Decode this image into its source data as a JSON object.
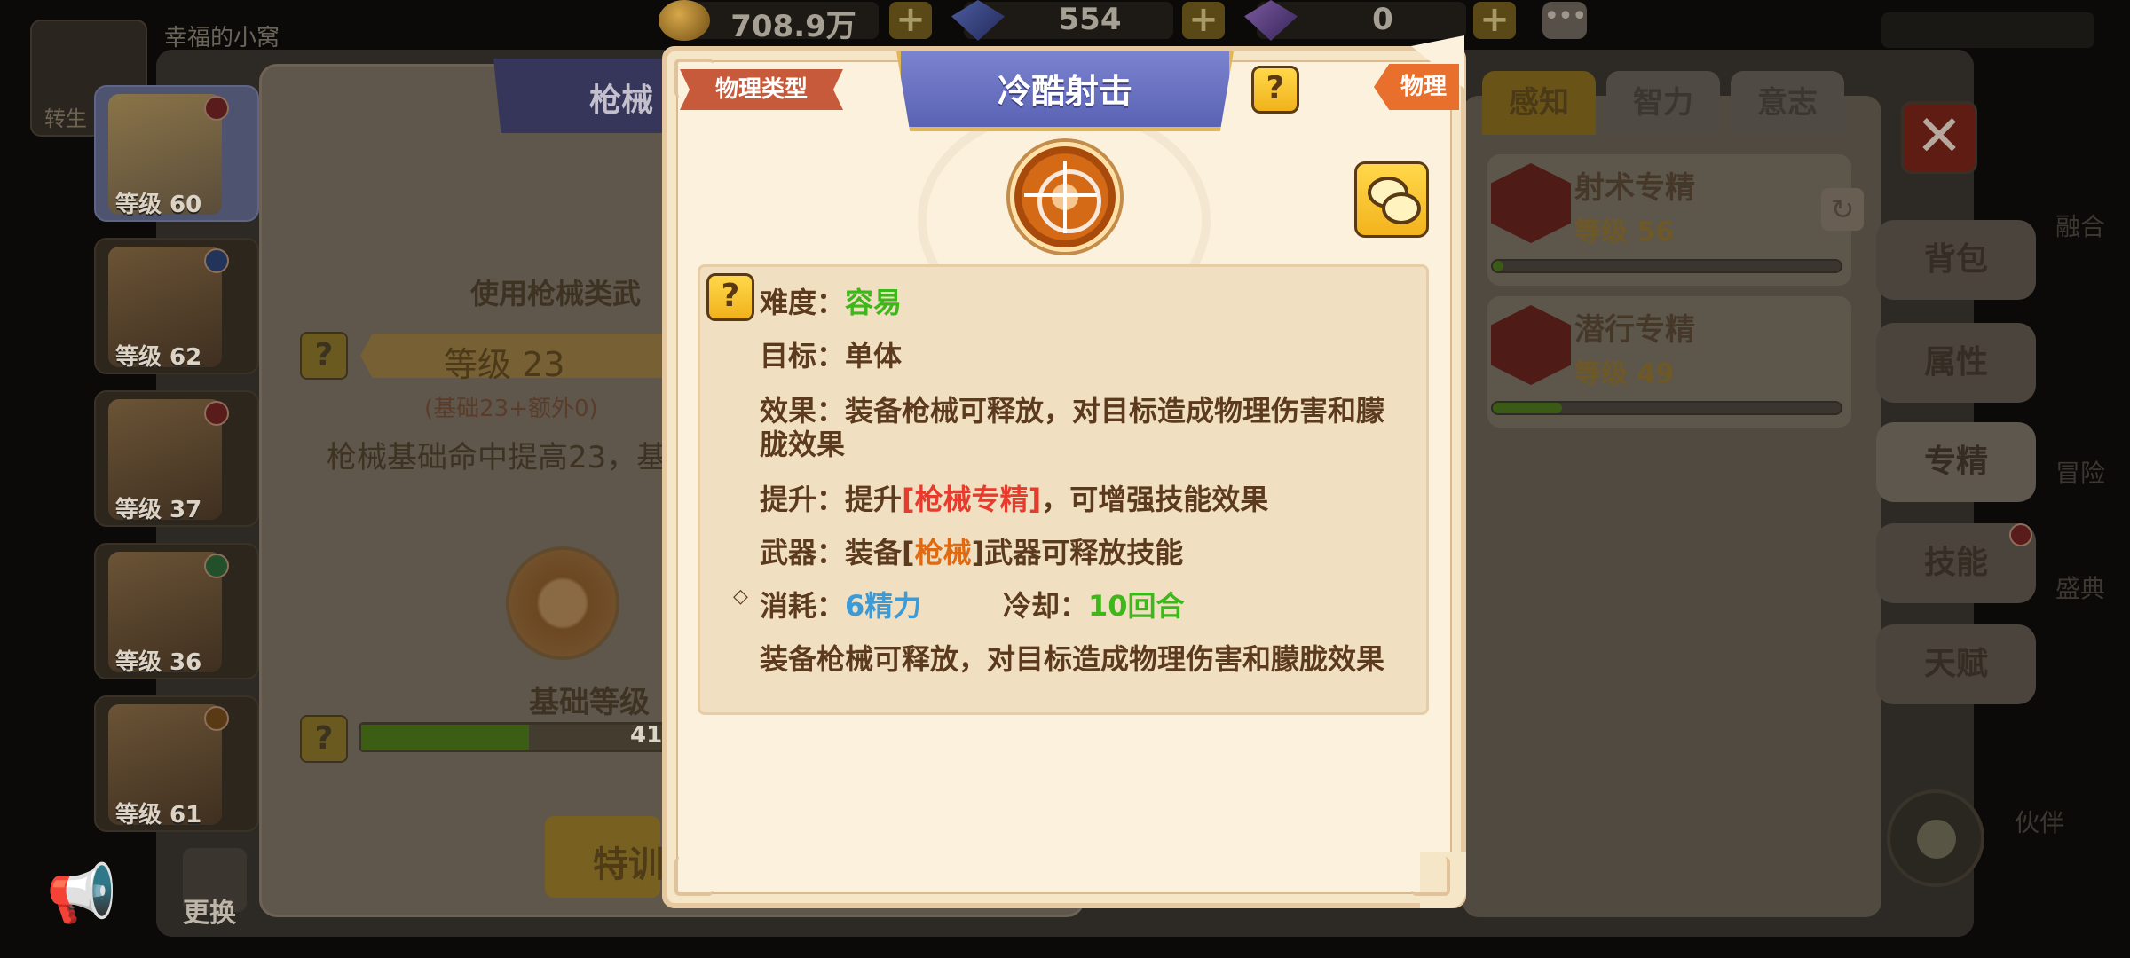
{
  "topbar": {
    "player_name": "幸福的小窝",
    "gold": "708.9万",
    "gems": "554",
    "special": "0",
    "plus": "+",
    "more": "•••"
  },
  "top_avatar_label": "转生",
  "heroes": [
    {
      "level": "等级 60"
    },
    {
      "level": "等级 62"
    },
    {
      "level": "等级 37"
    },
    {
      "level": "等级 36"
    },
    {
      "level": "等级 61"
    }
  ],
  "swap_label": "更换",
  "background": {
    "banner": "枪械",
    "use_text": "使用枪械类武",
    "level_label": "等级 23",
    "level_sub": "(基础23+额外0)",
    "desc": "枪械基础命中提高23，基",
    "base_level": "基础等级",
    "progress_text": "41",
    "progress_fraction": 0.55,
    "train_btn": "特训",
    "tabs": [
      {
        "label": "感知",
        "active": true
      },
      {
        "label": "智力",
        "active": false
      },
      {
        "label": "意志",
        "active": false
      }
    ],
    "close": "✕",
    "specs": [
      {
        "name": "射术专精",
        "level": "等级 56",
        "progress": 0.03
      },
      {
        "name": "潜行专精",
        "level": "等级 49",
        "progress": 0.2
      }
    ],
    "side_tabs": [
      {
        "label": "背包"
      },
      {
        "label": "属性"
      },
      {
        "label": "专精"
      },
      {
        "label": "技能"
      },
      {
        "label": "天赋"
      }
    ],
    "side_labels": [
      "融合",
      "冒险",
      "盛典",
      "伙伴"
    ]
  },
  "tooltip": {
    "type_ribbon": "物理类型",
    "title": "冷酷射击",
    "help": "?",
    "type_tag": "物理",
    "difficulty_label": "难度：",
    "difficulty_value": "容易",
    "target_label": "目标：",
    "target_value": "单体",
    "effect_label": "效果：",
    "effect_line1": "装备枪械可释放，对目标造成物理伤害和朦",
    "effect_line2": "胧效果",
    "upgrade_label": "提升：",
    "upgrade_pre": "提升",
    "upgrade_link": "[枪械专精]",
    "upgrade_post": "，可增强技能效果",
    "weapon_label": "武器：",
    "weapon_pre": "装备[",
    "weapon_link": "枪械",
    "weapon_post": "]武器可释放技能",
    "diamond": "◇",
    "cost_label": "消耗：",
    "cost_value": "6精力",
    "cooldown_label": "冷却：",
    "cooldown_value": "10回合",
    "summary": "装备枪械可释放，对目标造成物理伤害和朦胧效果"
  }
}
